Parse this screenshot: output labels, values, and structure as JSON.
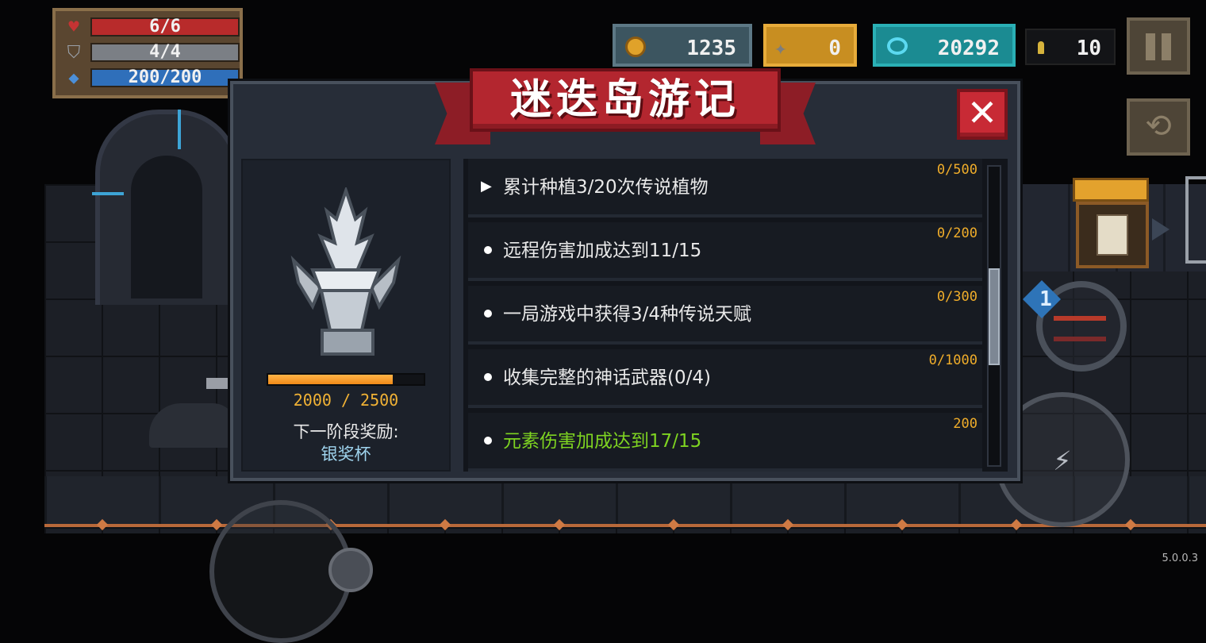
{
  "hud": {
    "hp": "6/6",
    "armor": "4/4",
    "energy": "200/200",
    "gold": "1235",
    "fish": "0",
    "gems": "20292",
    "ammo": "10"
  },
  "modal": {
    "title": "迷迭岛游记",
    "close_label": "✕",
    "reward": {
      "progress_current": 2000,
      "progress_max": 2500,
      "progress_text": "2000 / 2500",
      "next_label": "下一阶段奖励:",
      "next_value": "银奖杯"
    },
    "tasks": [
      {
        "marker": "arrow",
        "text": "累计种植3/20次传说植物",
        "reward": "0/500",
        "done": false
      },
      {
        "marker": "dot",
        "text": "远程伤害加成达到11/15",
        "reward": "0/200",
        "done": false
      },
      {
        "marker": "dot",
        "text": "一局游戏中获得3/4种传说天赋",
        "reward": "0/300",
        "done": false
      },
      {
        "marker": "dot",
        "text": "收集完整的神话武器(0/4)",
        "reward": "0/1000",
        "done": false
      },
      {
        "marker": "dot",
        "text": "元素伤害加成达到17/15",
        "reward": "200",
        "done": true
      }
    ],
    "scroll_position": 0.42
  },
  "controls": {
    "weapon_slot": "1"
  },
  "version": "5.0.0.3",
  "colors": {
    "hp": "#b82b2b",
    "energy": "#2f6fba",
    "banner": "#b3262f",
    "reward_text": "#f0ad2a",
    "completed_task": "#7ed321"
  }
}
